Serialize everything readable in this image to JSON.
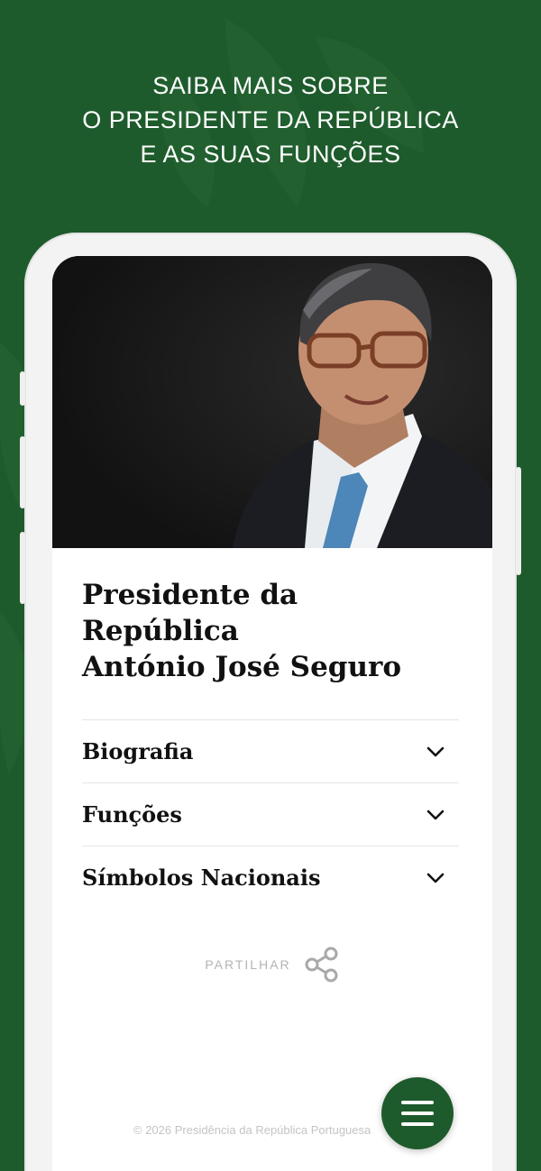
{
  "promo": {
    "line1": "SAIBA MAIS SOBRE",
    "line2": "O PRESIDENTE DA REPÚBLICA",
    "line3": "E AS SUAS FUNÇÕES"
  },
  "page": {
    "title_line1": "Presidente da República",
    "title_line2": "António José Seguro"
  },
  "accordion": [
    {
      "label": "Biografia",
      "icon": "chevron-down-icon"
    },
    {
      "label": "Funções",
      "icon": "chevron-down-icon"
    },
    {
      "label": "Símbolos Nacionais",
      "icon": "chevron-down-icon"
    }
  ],
  "share": {
    "label": "PARTILHAR",
    "icon": "share-icon"
  },
  "footer": {
    "text": "© 2026 Presidência da República Portuguesa"
  },
  "menu_button": {
    "icon": "hamburger-menu-icon"
  },
  "colors": {
    "brand_green": "#1e5b2c",
    "text": "#111111",
    "muted": "#b3b3b3"
  }
}
